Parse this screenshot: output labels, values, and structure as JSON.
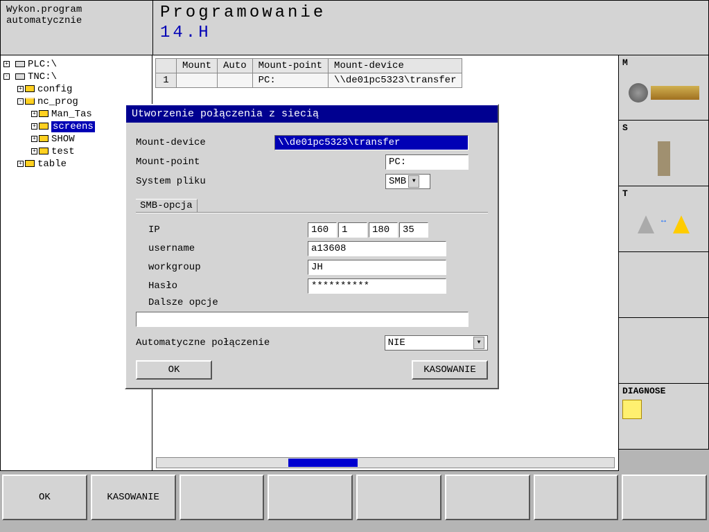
{
  "topbar": {
    "mode_line1": "Wykon.program",
    "mode_line2": "automatycznie",
    "title": "Programowanie",
    "subtitle": "14.H"
  },
  "tree": {
    "plc": "PLC:\\",
    "tnc": "TNC:\\",
    "config": "config",
    "nc_prog": "nc_prog",
    "man_tas": "Man_Tas",
    "screens": "screens",
    "show": "SHOW",
    "test": "test",
    "table": "table"
  },
  "mount_table": {
    "h_mount": "Mount",
    "h_auto": "Auto",
    "h_point": "Mount-point",
    "h_device": "Mount-device",
    "row1_num": "1",
    "row1_point": "PC:",
    "row1_device": "\\\\de01pc5323\\transfer"
  },
  "dialog": {
    "title": "Utworzenie połączenia z siecią",
    "mount_device_label": "Mount-device",
    "mount_device_value": "\\\\de01pc5323\\transfer",
    "mount_point_label": "Mount-point",
    "mount_point_value": "PC:",
    "fs_label": "System pliku",
    "fs_value": "SMB",
    "smb_group": "SMB-opcja",
    "ip_label": "IP",
    "ip1": "160",
    "ip2": "1",
    "ip3": "180",
    "ip4": "35",
    "user_label": "username",
    "user_value": "a13608",
    "wg_label": "workgroup",
    "wg_value": "JH",
    "pass_label": "Hasło",
    "pass_value": "**********",
    "more_label": "Dalsze opcje",
    "more_value": "",
    "auto_label": "Automatyczne połączenie",
    "auto_value": "NIE",
    "ok": "OK",
    "cancel": "KASOWANIE"
  },
  "side": {
    "m": "M",
    "s": "S",
    "t": "T",
    "diagnose": "DIAGNOSE"
  },
  "softkeys": {
    "sk1": "OK",
    "sk2": "KASOWANIE",
    "sk3": "",
    "sk4": "",
    "sk5": "",
    "sk6": "",
    "sk7": "",
    "sk8": ""
  }
}
